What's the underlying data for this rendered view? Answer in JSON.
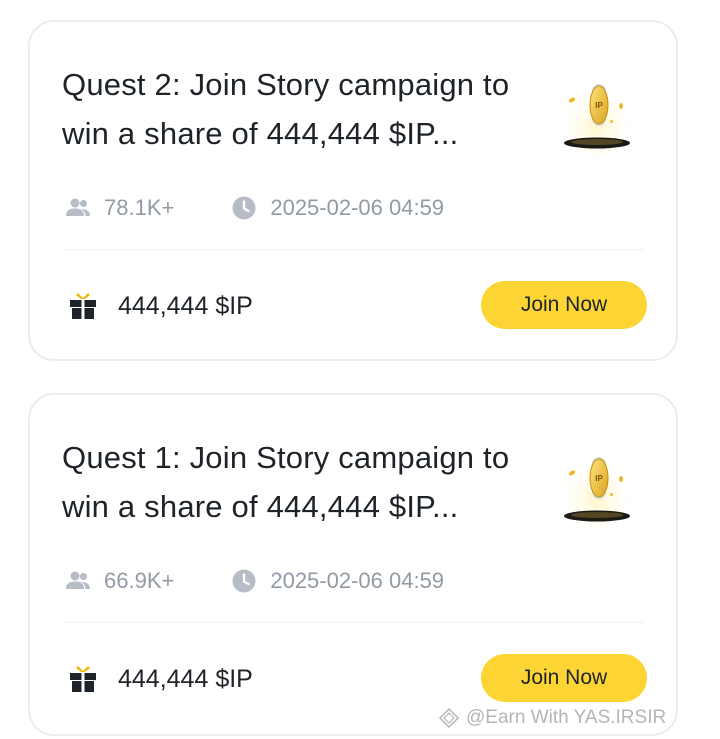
{
  "quests": [
    {
      "title": "Quest 2: Join Story campaign to win a share of 444,444 $IP...",
      "participants": "78.1K+",
      "end_time": "2025-02-06 04:59",
      "reward": "444,444 $IP",
      "button_label": "Join Now",
      "coin_label": "IP"
    },
    {
      "title": "Quest 1: Join Story campaign to win a share of 444,444 $IP...",
      "participants": "66.9K+",
      "end_time": "2025-02-06 04:59",
      "reward": "444,444 $IP",
      "button_label": "Join Now",
      "coin_label": "IP"
    }
  ],
  "watermark": {
    "text": "@Earn With YAS.IRSIR"
  },
  "icons": {
    "participants": "people-icon",
    "time": "clock-icon",
    "reward": "gift-icon",
    "artwork": "ip-coin-icon"
  },
  "colors": {
    "accent": "#FCD535",
    "text_primary": "#1E2329",
    "text_secondary": "#929AA5",
    "card_border": "#EAECEF"
  }
}
